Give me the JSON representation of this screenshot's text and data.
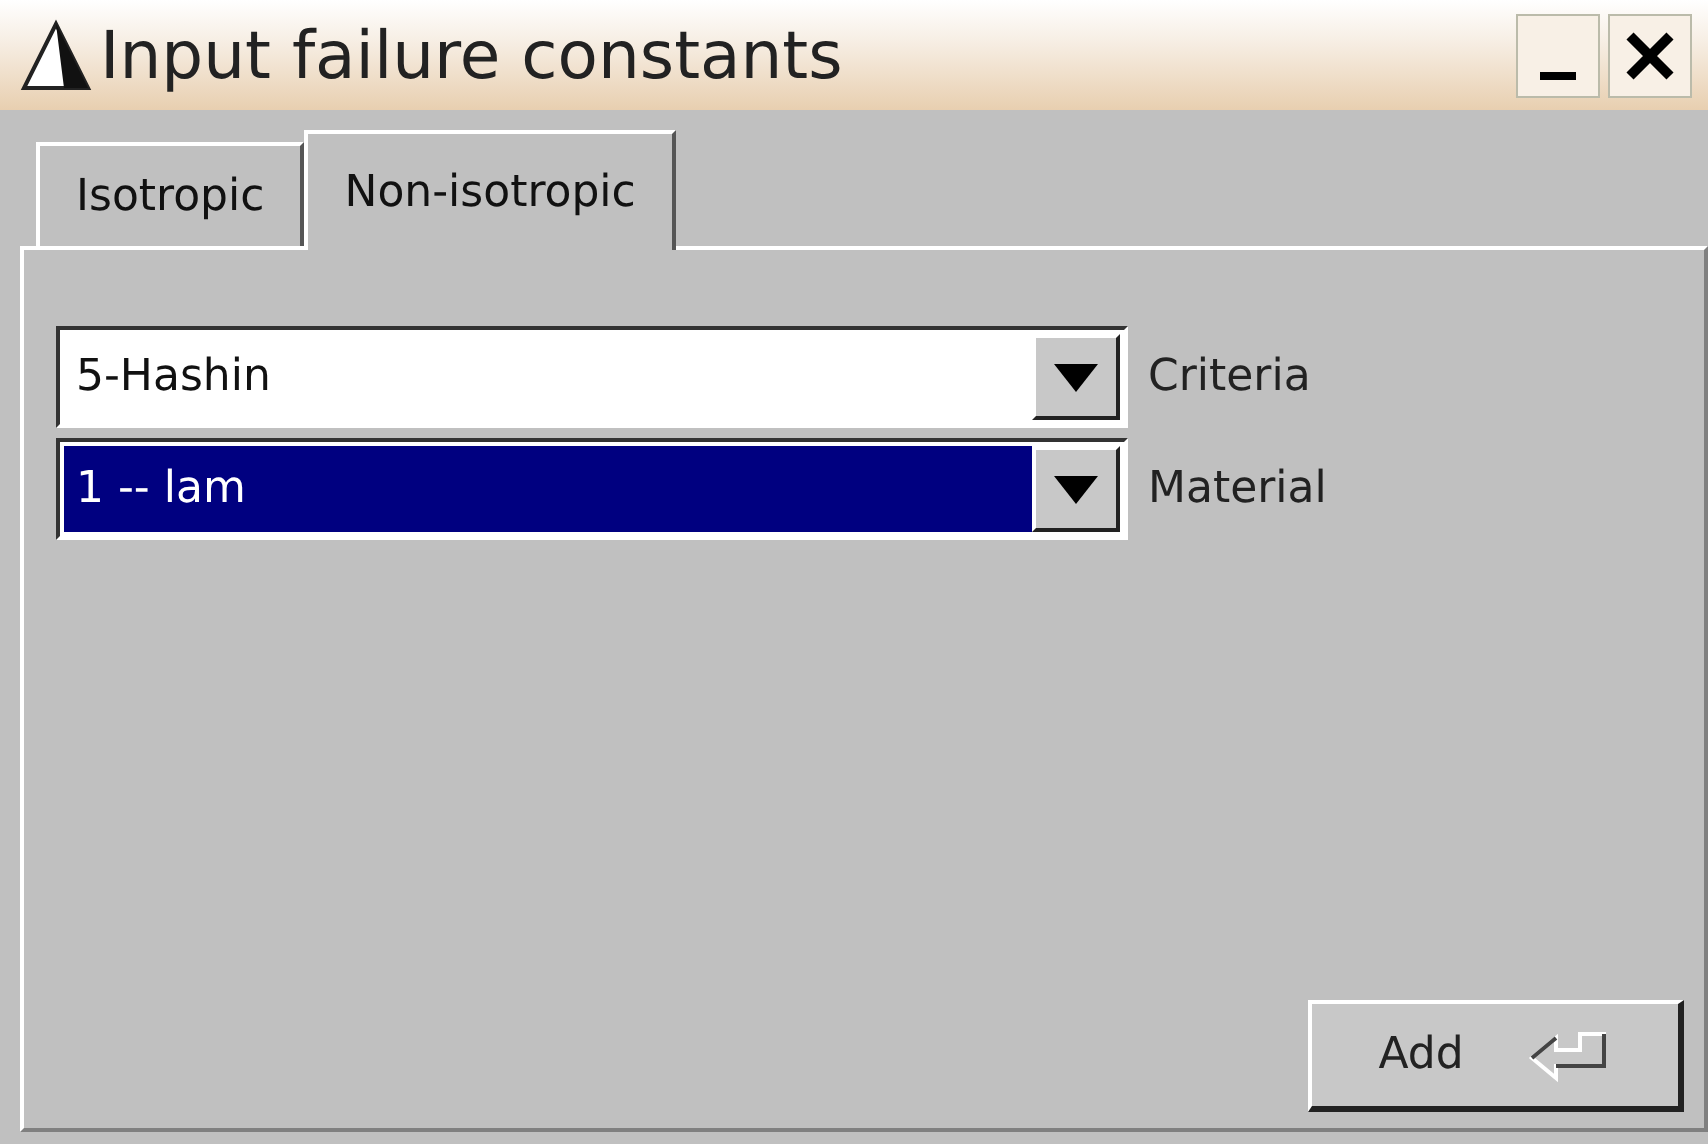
{
  "window": {
    "title": "Input failure constants"
  },
  "tabs": [
    {
      "label": "Isotropic",
      "selected": false
    },
    {
      "label": "Non-isotropic",
      "selected": true
    }
  ],
  "fields": [
    {
      "value": "5-Hashin",
      "label": "Criteria",
      "highlighted": false
    },
    {
      "value": "1 -- lam",
      "label": "Material",
      "highlighted": true
    }
  ],
  "add_button": {
    "label": "Add"
  }
}
